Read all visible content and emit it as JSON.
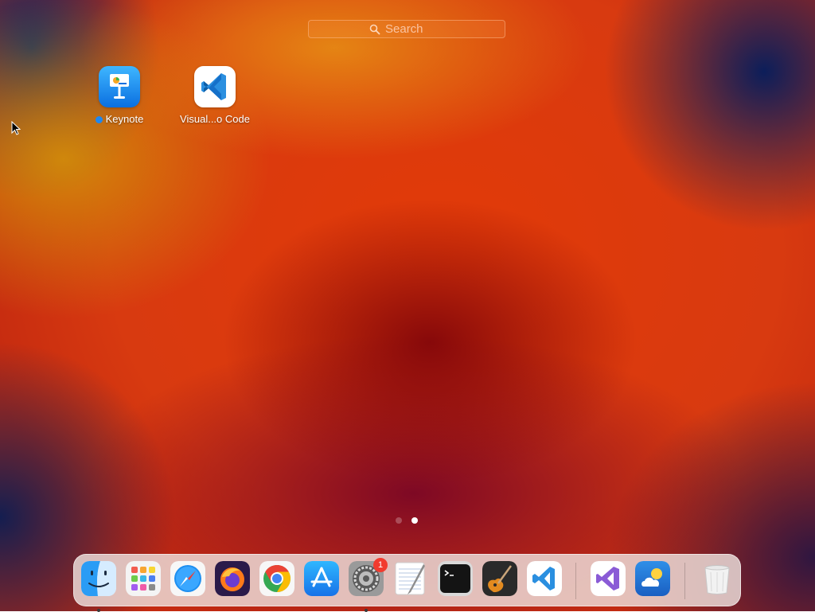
{
  "search": {
    "placeholder": "Search"
  },
  "apps": [
    {
      "label": "Keynote",
      "has_new_indicator": true
    },
    {
      "label": "Visual...o Code",
      "has_new_indicator": false
    }
  ],
  "pages": {
    "count": 2,
    "current": 2
  },
  "dock": {
    "items": [
      {
        "name": "Finder",
        "icon": "finder-icon",
        "running": true
      },
      {
        "name": "Launchpad",
        "icon": "launchpad-icon",
        "running": false
      },
      {
        "name": "Safari",
        "icon": "safari-icon",
        "running": false
      },
      {
        "name": "Firefox",
        "icon": "firefox-icon",
        "running": false
      },
      {
        "name": "Google Chrome",
        "icon": "chrome-icon",
        "running": false
      },
      {
        "name": "App Store",
        "icon": "app-store-icon",
        "running": false
      },
      {
        "name": "System Preferences",
        "icon": "system-preferences-icon",
        "running": true,
        "badge": "1"
      },
      {
        "name": "TextEdit",
        "icon": "textedit-icon",
        "running": false
      },
      {
        "name": "Terminal",
        "icon": "terminal-icon",
        "running": false
      },
      {
        "name": "GarageBand",
        "icon": "garageband-icon",
        "running": false
      },
      {
        "name": "Visual Studio Code",
        "icon": "vscode-icon",
        "running": false
      },
      {
        "name": "Visual Studio",
        "icon": "visual-studio-icon",
        "running": false
      },
      {
        "name": "Weather",
        "icon": "weather-icon",
        "running": false
      },
      {
        "name": "Trash",
        "icon": "trash-icon",
        "running": false
      }
    ]
  },
  "colors": {
    "accent_blue": "#1e88f0",
    "badge_red": "#f23b2e",
    "vscode_blue": "#2a8fe0"
  }
}
